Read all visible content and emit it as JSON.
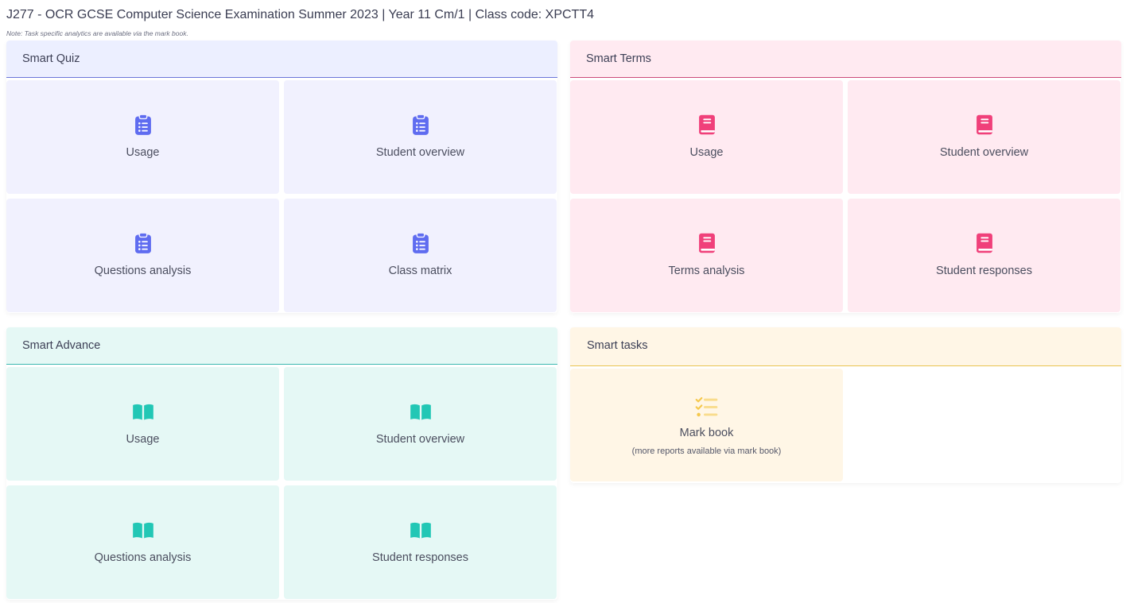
{
  "page": {
    "title": "J277 - OCR GCSE Computer Science Examination Summer 2023 | Year 11 Cm/1 | Class code: XPCTT4",
    "note": "Note: Task specific analytics are available via the mark book."
  },
  "colors": {
    "quiz_accent": "#5f6cf0",
    "terms_accent": "#f0407a",
    "advance_accent": "#22c7b5",
    "tasks_accent": "#f7d36b"
  },
  "smart_quiz": {
    "title": "Smart Quiz",
    "icon": "clipboard-list-icon",
    "tiles": [
      {
        "label": "Usage"
      },
      {
        "label": "Student overview"
      },
      {
        "label": "Questions analysis"
      },
      {
        "label": "Class matrix"
      }
    ]
  },
  "smart_terms": {
    "title": "Smart Terms",
    "icon": "book-closed-icon",
    "tiles": [
      {
        "label": "Usage"
      },
      {
        "label": "Student overview"
      },
      {
        "label": "Terms analysis"
      },
      {
        "label": "Student responses"
      }
    ]
  },
  "smart_advance": {
    "title": "Smart Advance",
    "icon": "book-open-icon",
    "tiles": [
      {
        "label": "Usage"
      },
      {
        "label": "Student overview"
      },
      {
        "label": "Questions analysis"
      },
      {
        "label": "Student responses"
      }
    ]
  },
  "smart_tasks": {
    "title": "Smart tasks",
    "icon": "task-list-icon",
    "tiles": [
      {
        "label": "Mark book",
        "sub": "(more reports available via mark book)"
      }
    ]
  }
}
